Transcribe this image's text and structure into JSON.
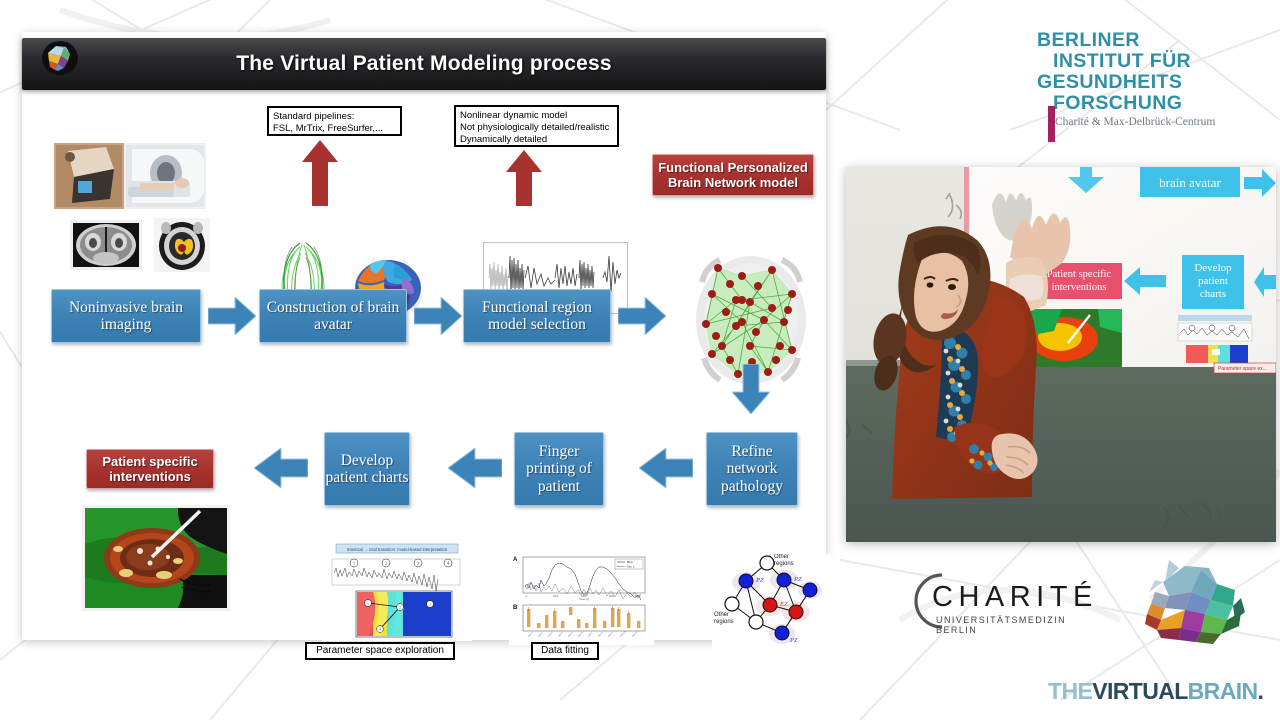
{
  "slide": {
    "title": "The Virtual Patient Modeling process",
    "logo_icon": "tvb-brain-logo-icon",
    "annotations": [
      {
        "name": "standard-pipelines-note",
        "lines": [
          "Standard pipelines:",
          "FSL, MrTrix, FreeSurfer,..."
        ]
      },
      {
        "name": "dynamic-model-note",
        "lines": [
          "Nonlinear dynamic model",
          "Not physiologically detailed/realistic",
          "Dynamically detailed"
        ]
      }
    ],
    "top_row": [
      {
        "name": "noninvasive-brain-imaging-box",
        "label": "Noninvasive brain imaging",
        "style": "blue"
      },
      {
        "name": "construction-of-brain-avatar-box",
        "label": "Construction of brain avatar",
        "style": "blue"
      },
      {
        "name": "functional-region-model-selection-box",
        "label": "Functional region model selection",
        "style": "blue"
      }
    ],
    "network_model_box": {
      "name": "functional-personalized-brain-network-model-box",
      "label": "Functional Personalized Brain Network model",
      "style": "red"
    },
    "bottom_row": [
      {
        "name": "refine-network-pathology-box",
        "label": "Refine network pathology",
        "style": "blue"
      },
      {
        "name": "finger-printing-of-patient-box",
        "label": "Finger printing of patient",
        "style": "blue"
      },
      {
        "name": "develop-patient-charts-box",
        "label": "Develop patient charts",
        "style": "blue"
      },
      {
        "name": "patient-specific-interventions-box",
        "label": "Patient specific interventions",
        "style": "red"
      }
    ],
    "captions": [
      {
        "name": "parameter-space-exploration-caption",
        "label": "Parameter space exploration"
      },
      {
        "name": "data-fitting-caption",
        "label": "Data fitting"
      }
    ],
    "chart_titles": {
      "interictal_banner": "Interictal → ictal transition: model-based interpretation",
      "panel_a": "A",
      "panel_b": "B"
    },
    "network_graph_labels": {
      "other_regions_top": "Other regions",
      "other_regions_left": "Other regions",
      "pz": "PZ",
      "ez": "EZ"
    },
    "images": [
      {
        "name": "mri-scanner-photo"
      },
      {
        "name": "structural-mri-slice"
      },
      {
        "name": "pet-brain-slice"
      },
      {
        "name": "tractography-brain-render"
      },
      {
        "name": "parcellation-brain-render"
      },
      {
        "name": "eeg-signal-trace"
      },
      {
        "name": "brain-connectome-render"
      },
      {
        "name": "surgery-photo"
      },
      {
        "name": "parameter-space-plot"
      },
      {
        "name": "data-fitting-plot"
      },
      {
        "name": "epileptor-network-graph"
      }
    ]
  },
  "video": {
    "name": "presentation-video",
    "projected_slide_labels": {
      "brain_avatar": "brain avatar",
      "patient_specific_interventions": "Patient specific interventions",
      "develop_patient_charts": "Develop patient charts",
      "parameter_space": "Parameter space ex..."
    }
  },
  "bih_logo": {
    "line1": "BERLINER",
    "line2": "INSTITUT FÜR",
    "line3": "GESUNDHEITS",
    "line4": "FORSCHUNG",
    "subtitle": "Charité & Max-Delbrück-Centrum",
    "accent_color": "#2e8fa8",
    "bar_color": "#a52060"
  },
  "charite_logo": {
    "name": "CHARITÉ",
    "subtitle": "UNIVERSITÄTSMEDIZIN BERLIN"
  },
  "tvb_logo": {
    "part1": "THE",
    "part2": "VIRTUAL",
    "part3": "BRAIN",
    "part4": "."
  },
  "colors": {
    "blue_box": "#3e82b6",
    "red_box": "#a8322f",
    "arrow_blue": "#3c84b8",
    "arrow_red": "#a8322f",
    "background": "#ffffff"
  }
}
